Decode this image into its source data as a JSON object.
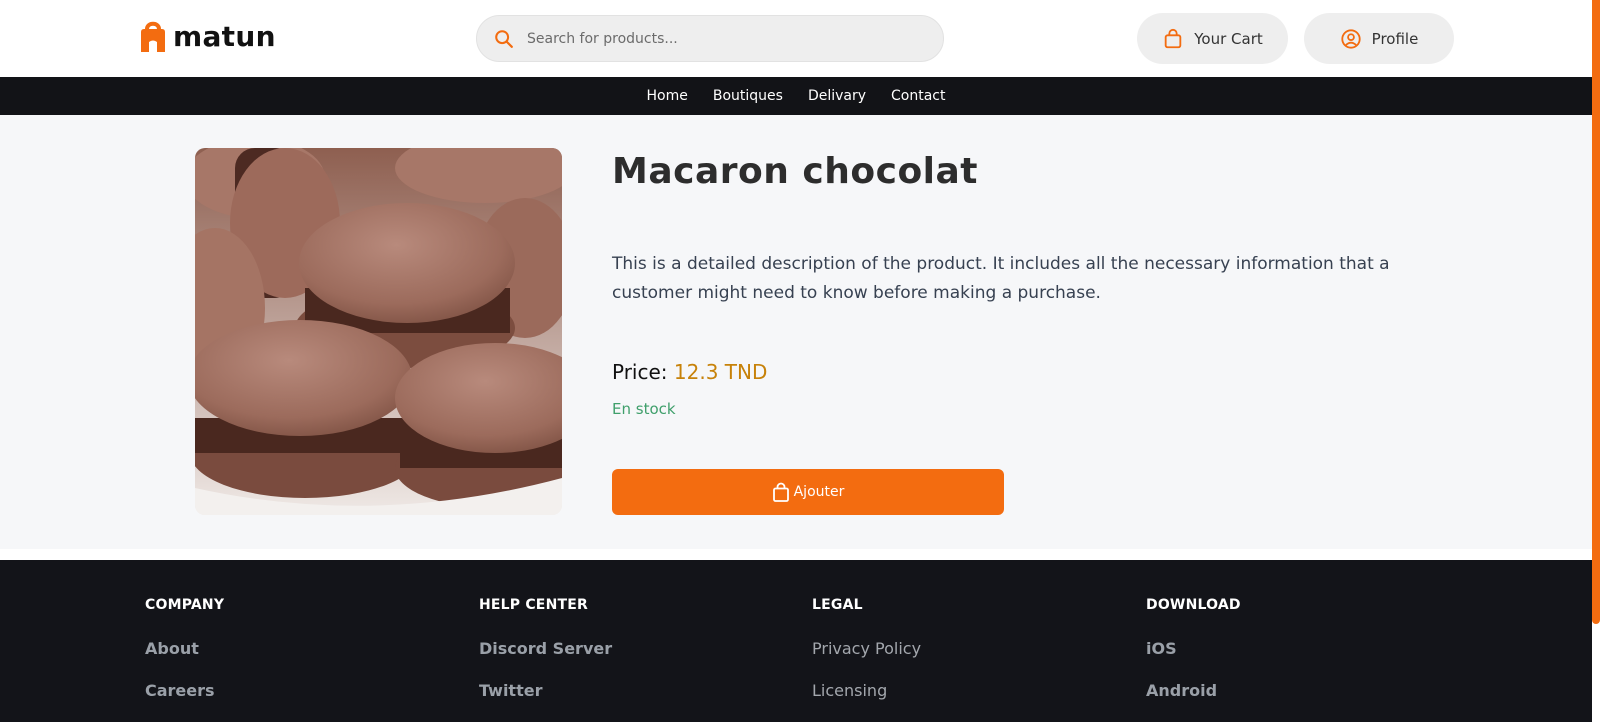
{
  "header": {
    "brand": "matun",
    "search_placeholder": "Search for products...",
    "cart_label": "Your Cart",
    "profile_label": "Profile"
  },
  "nav": {
    "items": [
      "Home",
      "Boutiques",
      "Delivary",
      "Contact"
    ]
  },
  "product": {
    "title": "Macaron chocolat",
    "description": "This is a detailed description of the product. It includes all the necessary information that a customer might need to know before making a purchase.",
    "price_label": "Price:",
    "price_value": "12.3 TND",
    "stock": "En stock",
    "add_button": "Ajouter"
  },
  "footer": {
    "columns": [
      {
        "heading": "COMPANY",
        "links": [
          "About",
          "Careers"
        ]
      },
      {
        "heading": "HELP CENTER",
        "links": [
          "Discord Server",
          "Twitter"
        ]
      },
      {
        "heading": "LEGAL",
        "links": [
          "Privacy Policy",
          "Licensing"
        ]
      },
      {
        "heading": "DOWNLOAD",
        "links": [
          "iOS",
          "Android"
        ]
      }
    ]
  },
  "colors": {
    "accent": "#f36c10",
    "nav_bg": "#121317",
    "price": "#c7820a",
    "in_stock": "#3f9f6b"
  },
  "icons": {
    "logo": "shopping-bag-logo-icon",
    "search": "search-icon",
    "cart": "shopping-bag-icon",
    "profile": "user-circle-icon"
  }
}
